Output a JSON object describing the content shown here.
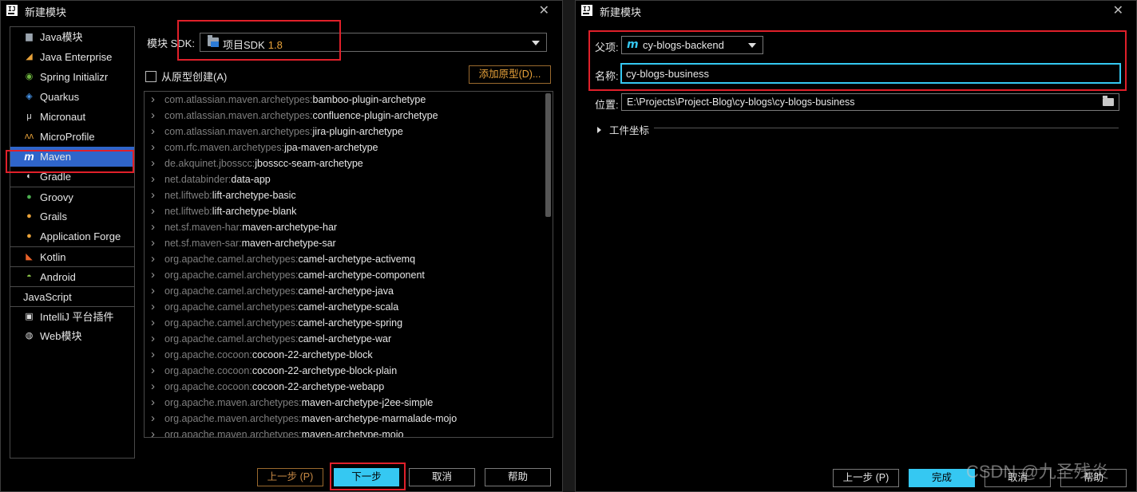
{
  "left_window": {
    "title": "新建模块",
    "logo_text": "IJ",
    "close_label": "✕",
    "sidebar": [
      {
        "label": "Java模块",
        "icon": "folder-icon",
        "glyph": "▆",
        "color": "#9aa4ae"
      },
      {
        "label": "Java Enterprise",
        "icon": "java-enterprise-icon",
        "glyph": "◢",
        "color": "#e8a23a"
      },
      {
        "label": "Spring Initializr",
        "icon": "spring-icon",
        "glyph": "◉",
        "color": "#6db33f"
      },
      {
        "label": "Quarkus",
        "icon": "quarkus-icon",
        "glyph": "◈",
        "color": "#4695eb"
      },
      {
        "label": "Micronaut",
        "icon": "micronaut-icon",
        "glyph": "μ",
        "color": "#dddddd"
      },
      {
        "label": "MicroProfile",
        "icon": "microprofile-icon",
        "glyph": "ᴧᴧ",
        "color": "#e8a23a"
      },
      {
        "label": "Maven",
        "icon": "maven-icon",
        "glyph": "m",
        "color": "#35c8f2",
        "selected": true
      },
      {
        "label": "Gradle",
        "icon": "gradle-icon",
        "glyph": "◐",
        "color": "#dddddd"
      },
      {
        "label": "Groovy",
        "icon": "groovy-icon",
        "glyph": "●",
        "color": "#4caf50",
        "sep": true
      },
      {
        "label": "Grails",
        "icon": "grails-icon",
        "glyph": "●",
        "color": "#e8a23a"
      },
      {
        "label": "Application Forge",
        "icon": "application-forge-icon",
        "glyph": "●",
        "color": "#e8a23a"
      },
      {
        "label": "Kotlin",
        "icon": "kotlin-icon",
        "glyph": "◣",
        "color": "#e8622a",
        "sep": true
      },
      {
        "label": "Android",
        "icon": "android-icon",
        "glyph": "◓",
        "color": "#8bc34a",
        "sep": true
      },
      {
        "label": "JavaScript",
        "icon": "",
        "glyph": "",
        "color": "",
        "sep": true,
        "noicon": true
      },
      {
        "label": "IntelliJ 平台插件",
        "icon": "plugin-icon",
        "glyph": "▣",
        "color": "#dddddd",
        "sep": true
      },
      {
        "label": "Web模块",
        "icon": "globe-icon",
        "glyph": "◍",
        "color": "#dddddd"
      }
    ],
    "sdk_label": "模块 SDK:",
    "sdk_value": "项目SDK",
    "sdk_version": "1.8",
    "archetype_checkbox_label": "从原型创建(A)",
    "add_archetype_label": "添加原型(D)...",
    "archetypes": [
      {
        "group": "com.atlassian.maven.archetypes:",
        "artifact": "bamboo-plugin-archetype"
      },
      {
        "group": "com.atlassian.maven.archetypes:",
        "artifact": "confluence-plugin-archetype"
      },
      {
        "group": "com.atlassian.maven.archetypes:",
        "artifact": "jira-plugin-archetype"
      },
      {
        "group": "com.rfc.maven.archetypes:",
        "artifact": "jpa-maven-archetype"
      },
      {
        "group": "de.akquinet.jbosscc:",
        "artifact": "jbosscc-seam-archetype"
      },
      {
        "group": "net.databinder:",
        "artifact": "data-app"
      },
      {
        "group": "net.liftweb:",
        "artifact": "lift-archetype-basic"
      },
      {
        "group": "net.liftweb:",
        "artifact": "lift-archetype-blank"
      },
      {
        "group": "net.sf.maven-har:",
        "artifact": "maven-archetype-har"
      },
      {
        "group": "net.sf.maven-sar:",
        "artifact": "maven-archetype-sar"
      },
      {
        "group": "org.apache.camel.archetypes:",
        "artifact": "camel-archetype-activemq"
      },
      {
        "group": "org.apache.camel.archetypes:",
        "artifact": "camel-archetype-component"
      },
      {
        "group": "org.apache.camel.archetypes:",
        "artifact": "camel-archetype-java"
      },
      {
        "group": "org.apache.camel.archetypes:",
        "artifact": "camel-archetype-scala"
      },
      {
        "group": "org.apache.camel.archetypes:",
        "artifact": "camel-archetype-spring"
      },
      {
        "group": "org.apache.camel.archetypes:",
        "artifact": "camel-archetype-war"
      },
      {
        "group": "org.apache.cocoon:",
        "artifact": "cocoon-22-archetype-block"
      },
      {
        "group": "org.apache.cocoon:",
        "artifact": "cocoon-22-archetype-block-plain"
      },
      {
        "group": "org.apache.cocoon:",
        "artifact": "cocoon-22-archetype-webapp"
      },
      {
        "group": "org.apache.maven.archetypes:",
        "artifact": "maven-archetype-j2ee-simple"
      },
      {
        "group": "org.apache.maven.archetypes:",
        "artifact": "maven-archetype-marmalade-mojo"
      },
      {
        "group": "org.apache.maven.archetypes:",
        "artifact": "maven-archetype-mojo"
      }
    ],
    "buttons": {
      "prev": "上一步 (P)",
      "next": "下一步",
      "cancel": "取消",
      "help": "帮助"
    }
  },
  "right_window": {
    "title": "新建模块",
    "logo_text": "IJ",
    "close_label": "✕",
    "parent_label": "父项:",
    "parent_value": "cy-blogs-backend",
    "name_label": "名称:",
    "name_value": "cy-blogs-business",
    "location_label": "位置:",
    "location_value": "E:\\Projects\\Project-Blog\\cy-blogs\\cy-blogs-business",
    "coords_label": "工件坐标",
    "buttons": {
      "prev": "上一步 (P)",
      "finish": "完成",
      "cancel": "取消",
      "help": "帮助"
    }
  },
  "watermark": "CSDN @九圣残炎",
  "colors": {
    "accent": "#35c8f2",
    "selection": "#2f65ca",
    "highlight_box": "#e0202a",
    "orange": "#e8a23a"
  }
}
